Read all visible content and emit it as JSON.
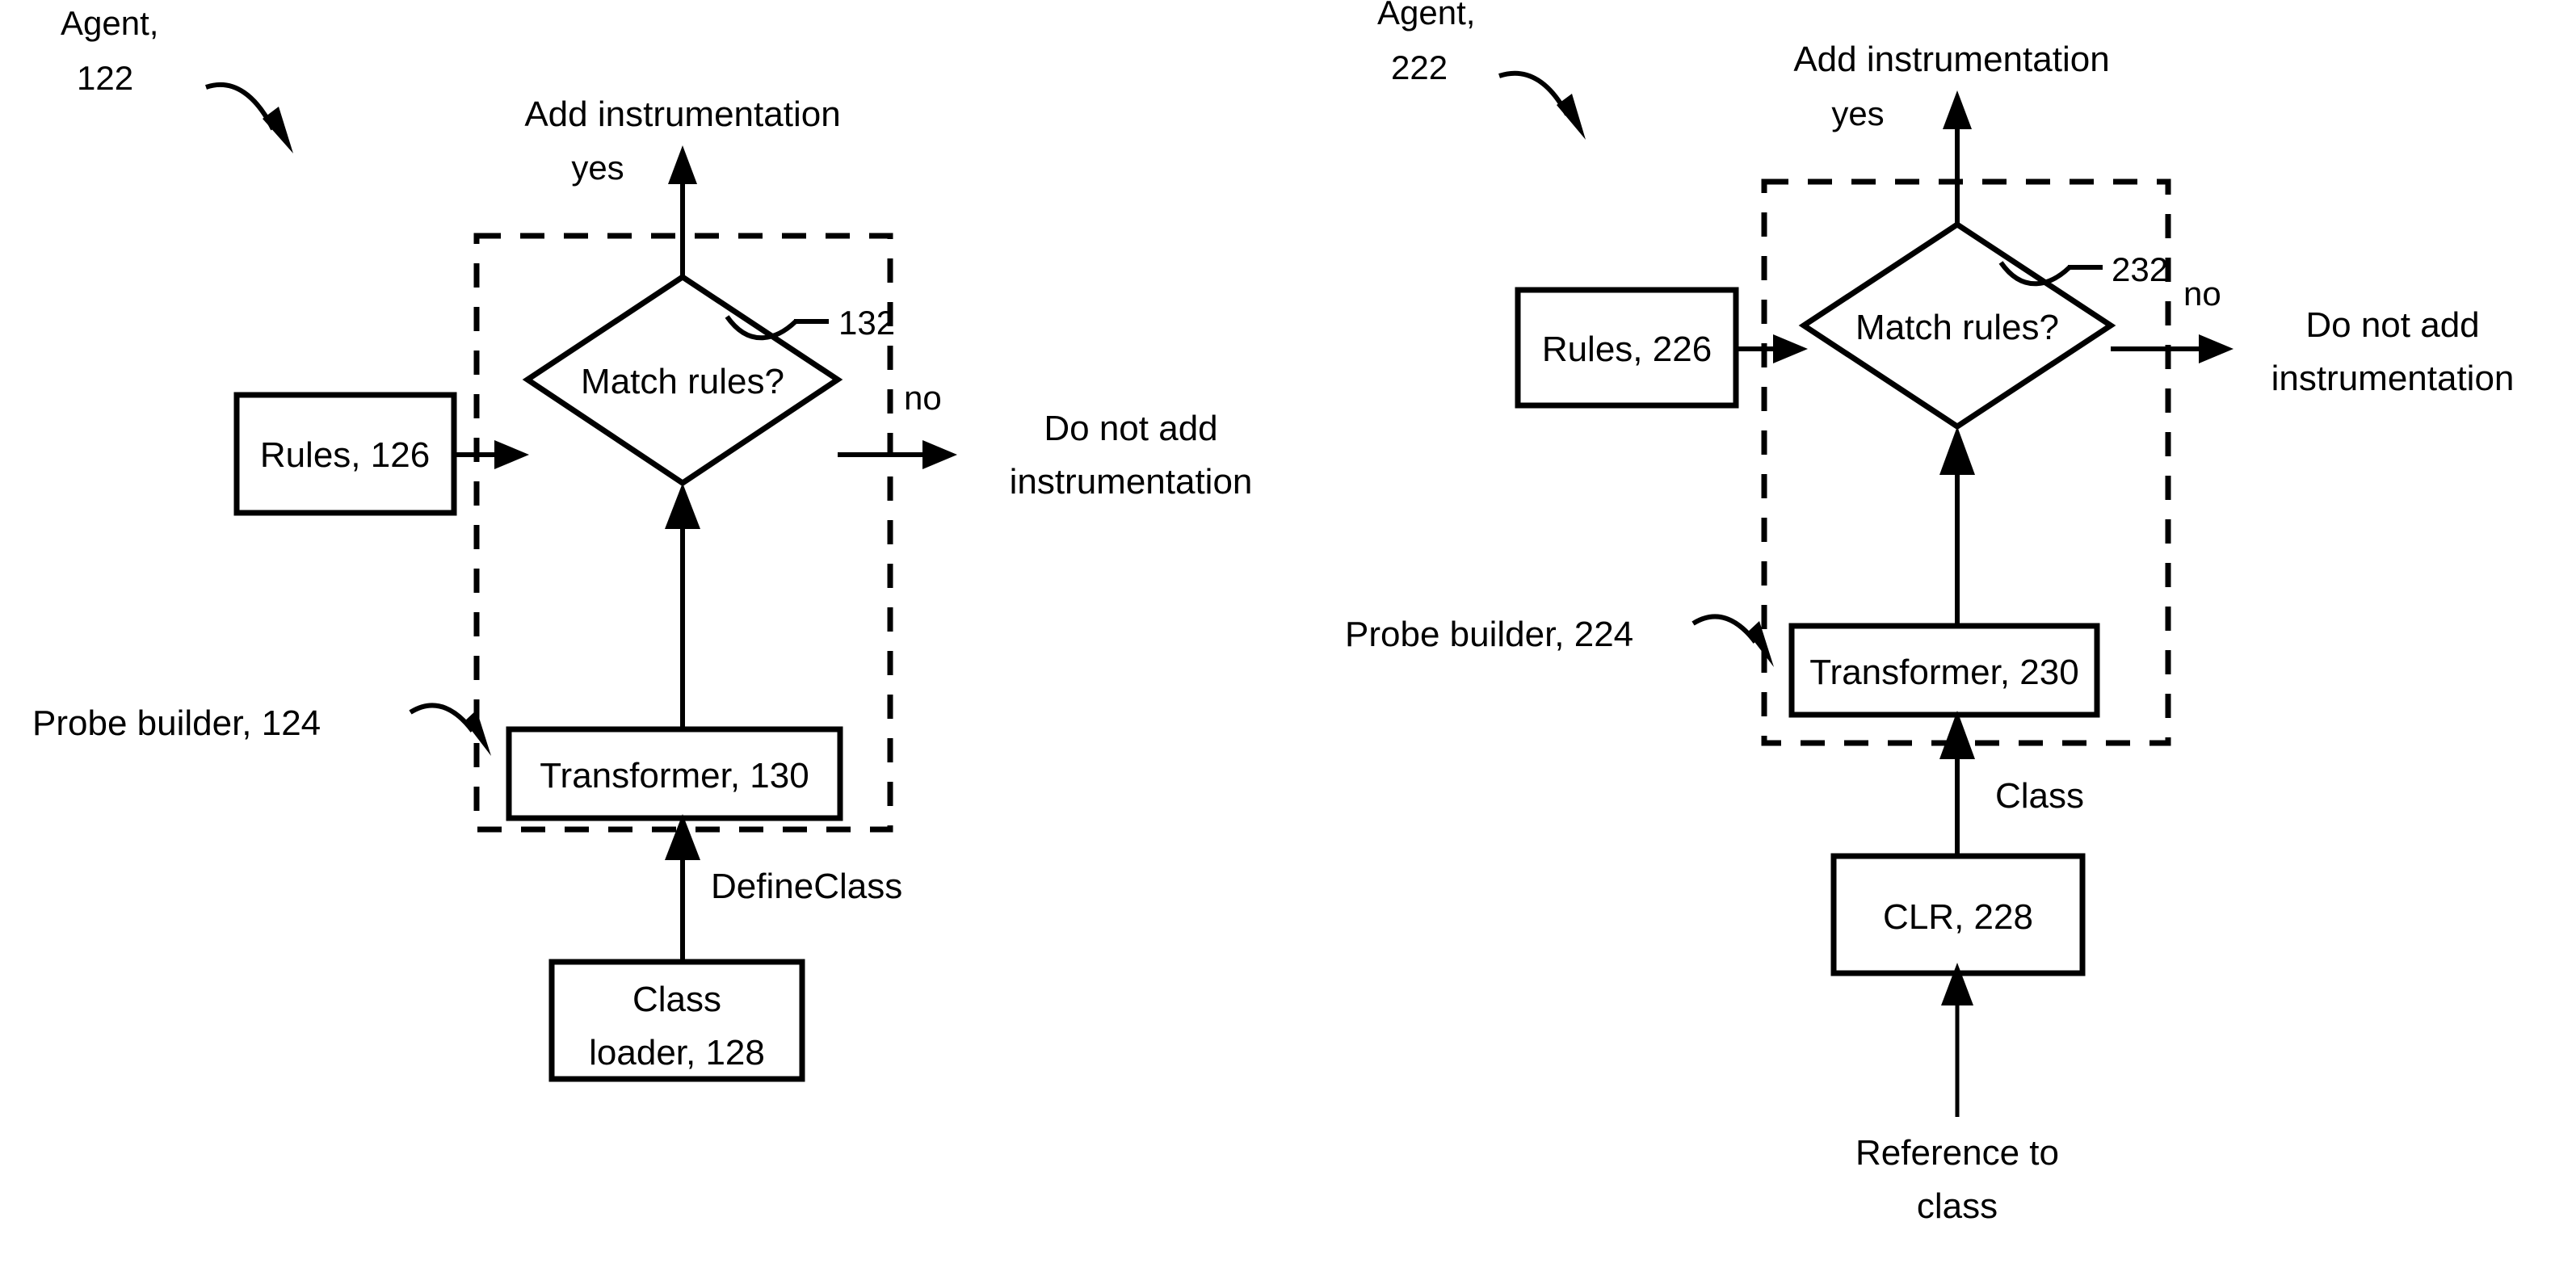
{
  "figure": {
    "title": "",
    "background_color": "#ffffff",
    "line_color": "#000000"
  },
  "left_diagram": {
    "agent_label_line1": "Agent,",
    "agent_label_line2": "122",
    "top_output_label": "Add instrumentation",
    "yes_label": "yes",
    "no_label": "no",
    "decision_text": "Match rules?",
    "decision_ref": "132",
    "rules_box": "Rules, 126",
    "probe_builder_label": "Probe builder, 124",
    "transformer_box": "Transformer, 130",
    "define_class_label": "DefineClass",
    "class_loader_line1": "Class",
    "class_loader_line2": "loader, 128",
    "no_output_line1": "Do not add",
    "no_output_line2": "instrumentation"
  },
  "right_diagram": {
    "agent_label_line1": "Agent,",
    "agent_label_line2": "222",
    "top_output_label": "Add instrumentation",
    "yes_label": "yes",
    "no_label": "no",
    "decision_text": "Match rules?",
    "decision_ref": "232",
    "rules_box": "Rules, 226",
    "probe_builder_label": "Probe builder, 224",
    "transformer_box": "Transformer, 230",
    "class_label": "Class",
    "clr_box": "CLR, 228",
    "reference_line1": "Reference to",
    "reference_line2": "class",
    "no_output_line1": "Do not add",
    "no_output_line2": "instrumentation"
  }
}
